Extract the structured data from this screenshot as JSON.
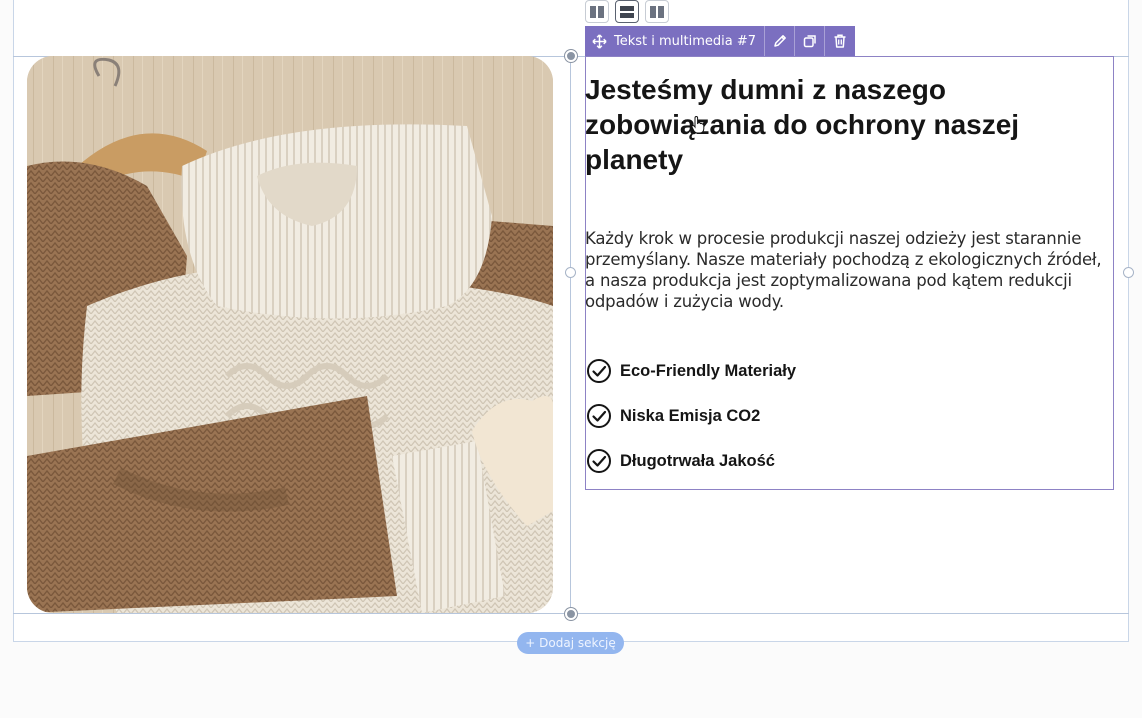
{
  "toolbar": {
    "block_name": "Tekst i multimedia #7",
    "move_icon": "move-icon",
    "edit_icon": "pencil-icon",
    "duplicate_icon": "duplicate-icon",
    "delete_icon": "trash-icon",
    "accent_color": "#7b6fc0"
  },
  "layout_switcher": {
    "options": [
      "two-columns",
      "stacked-rows",
      "two-columns-alt"
    ],
    "active": "stacked-rows"
  },
  "content": {
    "heading": "Jesteśmy dumni z naszego zobowiązania do ochrony naszej planety",
    "paragraph": "Każdy krok w procesie produkcji naszej odzieży jest starannie przemyślany. Nasze materiały pochodzą z ekologicznych źródeł, a nasza produkcja jest zoptymalizowana pod kątem redukcji odpadów i zużycia wody.",
    "features": [
      {
        "label": "Eco-Friendly Materiały",
        "icon": "check-circle-icon"
      },
      {
        "label": "Niska Emisja CO2",
        "icon": "check-circle-icon"
      },
      {
        "label": "Długotrwała Jakość",
        "icon": "check-circle-icon"
      }
    ]
  },
  "image": {
    "subject": "sweaters-photo"
  },
  "add_section": {
    "label": "+ Dodaj sekcję",
    "color": "#93b6ef"
  }
}
